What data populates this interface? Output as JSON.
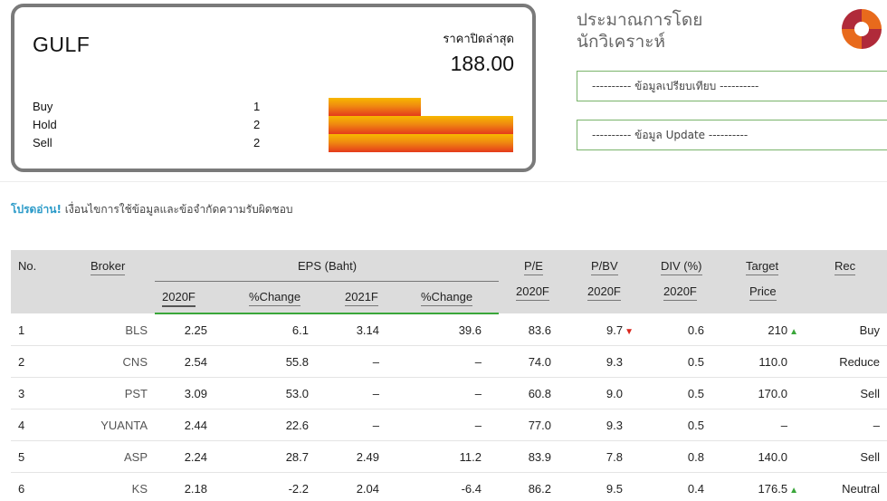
{
  "summary": {
    "symbol": "GULF",
    "close_label": "ราคาปิดล่าสุด",
    "close_price": "188.00",
    "votes": [
      {
        "label": "Buy",
        "count": "1",
        "fraction": 0.5
      },
      {
        "label": "Hold",
        "count": "2",
        "fraction": 1.0
      },
      {
        "label": "Sell",
        "count": "2",
        "fraction": 1.0
      }
    ],
    "bar_colors": [
      "#f7b800",
      "#f08a10",
      "#e53a1c"
    ]
  },
  "right_panel": {
    "title_line1": "ประมาณการโดย",
    "title_line2": "นักวิเคราะห์",
    "logo_icon": "brand-logo-icon",
    "compare_link": "---------- ข้อมูลเปรียบเทียบ ----------",
    "update_link": "---------- ข้อมูล Update ----------"
  },
  "notice": {
    "highlight": "โปรดอ่าน!",
    "text": " เงื่อนไขการใช้ข้อมูลและข้อจำกัดความรับผิดชอบ"
  },
  "table": {
    "headers": {
      "no": "No.",
      "broker": "Broker",
      "eps": "EPS (Baht)",
      "eps_2020": "2020F",
      "eps_2020_change": "%Change",
      "eps_2021": "2021F",
      "eps_2021_change": "%Change",
      "pe": "P/E",
      "pe_year": "2020F",
      "pbv": "P/BV",
      "pbv_year": "2020F",
      "div": "DIV (%)",
      "div_year": "2020F",
      "target": "Target",
      "target_sub": "Price",
      "rec": "Rec"
    },
    "rows": [
      {
        "no": "1",
        "broker": "BLS",
        "eps2020": "2.25",
        "chg2020": "6.1",
        "eps2021": "3.14",
        "chg2021": "39.6",
        "pe": "83.6",
        "pbv": "9.7",
        "pbv_trend": "down",
        "div": "0.6",
        "target": "210",
        "target_trend": "up",
        "rec": "Buy"
      },
      {
        "no": "2",
        "broker": "CNS",
        "eps2020": "2.54",
        "chg2020": "55.8",
        "eps2021": "–",
        "chg2021": "–",
        "pe": "74.0",
        "pbv": "9.3",
        "pbv_trend": "",
        "div": "0.5",
        "target": "110.0",
        "target_trend": "",
        "rec": "Reduce"
      },
      {
        "no": "3",
        "broker": "PST",
        "eps2020": "3.09",
        "chg2020": "53.0",
        "eps2021": "–",
        "chg2021": "–",
        "pe": "60.8",
        "pbv": "9.0",
        "pbv_trend": "",
        "div": "0.5",
        "target": "170.0",
        "target_trend": "",
        "rec": "Sell"
      },
      {
        "no": "4",
        "broker": "YUANTA",
        "eps2020": "2.44",
        "chg2020": "22.6",
        "eps2021": "–",
        "chg2021": "–",
        "pe": "77.0",
        "pbv": "9.3",
        "pbv_trend": "",
        "div": "0.5",
        "target": "–",
        "target_trend": "",
        "rec": "–"
      },
      {
        "no": "5",
        "broker": "ASP",
        "eps2020": "2.24",
        "chg2020": "28.7",
        "eps2021": "2.49",
        "chg2021": "11.2",
        "pe": "83.9",
        "pbv": "7.8",
        "pbv_trend": "",
        "div": "0.8",
        "target": "140.0",
        "target_trend": "",
        "rec": "Sell"
      },
      {
        "no": "6",
        "broker": "KS",
        "eps2020": "2.18",
        "chg2020": "-2.2",
        "eps2021": "2.04",
        "chg2021": "-6.4",
        "pe": "86.2",
        "pbv": "9.5",
        "pbv_trend": "",
        "div": "0.4",
        "target": "176.5",
        "target_trend": "up",
        "rec": "Neutral"
      }
    ]
  }
}
